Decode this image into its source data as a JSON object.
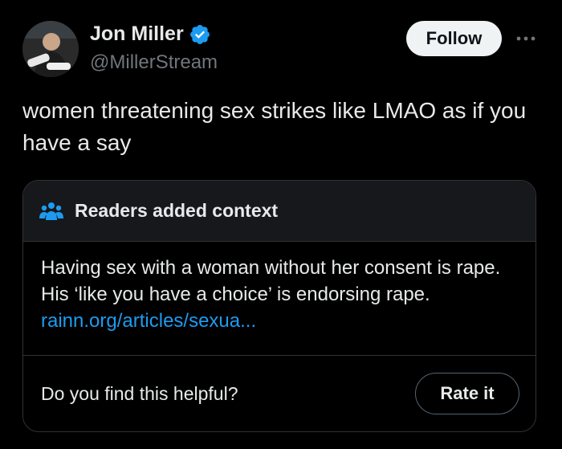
{
  "author": {
    "name": "Jon Miller",
    "handle": "@MillerStream",
    "verified": true,
    "verified_color": "#1d9bf0",
    "avatar_icon": "profile-photo"
  },
  "actions": {
    "follow_label": "Follow",
    "more_icon": "more-horizontal-icon"
  },
  "tweet": {
    "text": "women threatening sex strikes like LMAO as if you have a say"
  },
  "community_note": {
    "icon": "people-group-icon",
    "title": "Readers added context",
    "body": "Having sex with a woman without her consent is rape. His ‘like you have a choice’ is endorsing rape.",
    "link_text": "rainn.org/articles/sexua...",
    "helpful_prompt": "Do you find this helpful?",
    "rate_label": "Rate it"
  },
  "colors": {
    "background": "#000000",
    "text": "#e7e9ea",
    "muted": "#71767b",
    "link": "#1d9bf0",
    "border": "#2f3336",
    "note_header": "#16181c"
  }
}
